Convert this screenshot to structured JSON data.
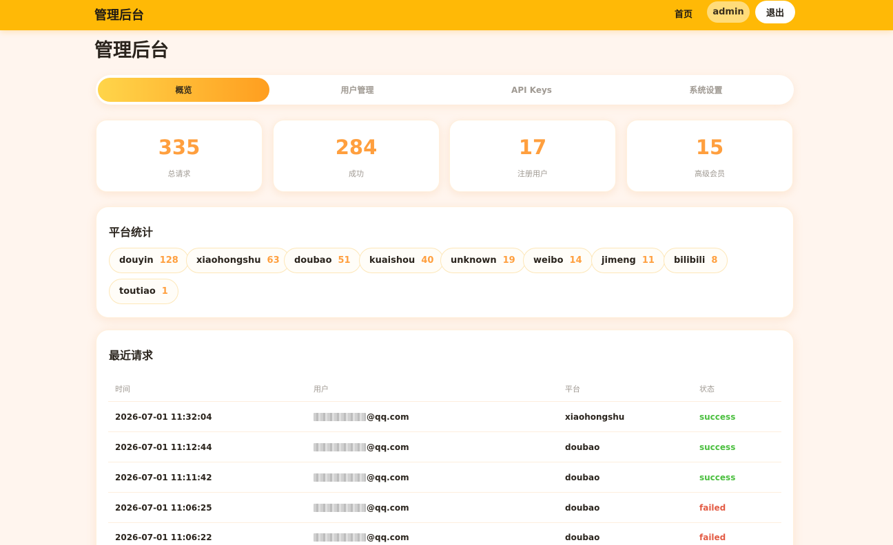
{
  "header": {
    "brand": "管理后台",
    "home_label": "首页",
    "user_label": "admin",
    "logout_label": "退出"
  },
  "page": {
    "title": "管理后台"
  },
  "tabs": [
    {
      "label": "概览",
      "active": true
    },
    {
      "label": "用户管理",
      "active": false
    },
    {
      "label": "API Keys",
      "active": false
    },
    {
      "label": "系统设置",
      "active": false
    }
  ],
  "stats": [
    {
      "value": "335",
      "label": "总请求"
    },
    {
      "value": "284",
      "label": "成功"
    },
    {
      "value": "17",
      "label": "注册用户"
    },
    {
      "value": "15",
      "label": "高级会员"
    }
  ],
  "platform_stats": {
    "title": "平台统计",
    "items": [
      {
        "name": "douyin",
        "count": "128"
      },
      {
        "name": "xiaohongshu",
        "count": "63"
      },
      {
        "name": "doubao",
        "count": "51"
      },
      {
        "name": "kuaishou",
        "count": "40"
      },
      {
        "name": "unknown",
        "count": "19"
      },
      {
        "name": "weibo",
        "count": "14"
      },
      {
        "name": "jimeng",
        "count": "11"
      },
      {
        "name": "bilibili",
        "count": "8"
      },
      {
        "name": "toutiao",
        "count": "1"
      }
    ]
  },
  "recent_requests": {
    "title": "最近请求",
    "columns": [
      "时间",
      "用户",
      "平台",
      "状态"
    ],
    "rows": [
      {
        "time": "2026-07-01 11:32:04",
        "user": "@qq.com",
        "platform": "xiaohongshu",
        "status": "success"
      },
      {
        "time": "2026-07-01 11:12:44",
        "user": "@qq.com",
        "platform": "doubao",
        "status": "success"
      },
      {
        "time": "2026-07-01 11:11:42",
        "user": "@qq.com",
        "platform": "doubao",
        "status": "success"
      },
      {
        "time": "2026-07-01 11:06:25",
        "user": "@qq.com",
        "platform": "doubao",
        "status": "failed"
      },
      {
        "time": "2026-07-01 11:06:22",
        "user": "@qq.com",
        "platform": "doubao",
        "status": "failed"
      }
    ]
  },
  "colors": {
    "accent": "#ffb906",
    "stat_number": "#ff9f3e",
    "success": "#4bbf3f",
    "failed": "#e35c45"
  }
}
